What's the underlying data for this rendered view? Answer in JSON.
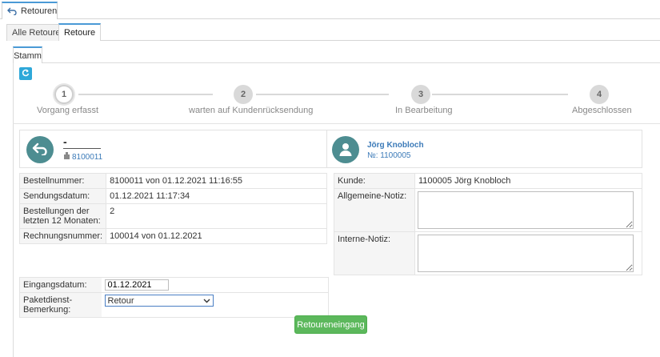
{
  "window_tab": {
    "label": "Retouren",
    "icon": "return-arrow-icon"
  },
  "tabs": [
    {
      "label": "Alle Retouren"
    },
    {
      "label": "Retoure"
    }
  ],
  "inner_tab": {
    "label": "Stamm"
  },
  "wizard": {
    "steps": [
      {
        "number": "1",
        "label": "Vorgang erfasst"
      },
      {
        "number": "2",
        "label": "warten auf Kundenrücksendung"
      },
      {
        "number": "3",
        "label": "In Bearbeitung"
      },
      {
        "number": "4",
        "label": "Abgeschlossen"
      }
    ],
    "current_step": 1
  },
  "return_card": {
    "title": "-",
    "order_ref": "8100011",
    "icon": "return-arrow-icon"
  },
  "customer_card": {
    "name": "Jörg Knobloch",
    "number": "№: 1100005",
    "icon": "user-icon"
  },
  "order_info": [
    {
      "label": "Bestellnummer:",
      "value": "8100011 von 01.12.2021 11:16:55"
    },
    {
      "label": "Sendungsdatum:",
      "value": "01.12.2021 11:17:34"
    },
    {
      "label": "Bestellungen der letzten 12 Monaten:",
      "value": "2"
    },
    {
      "label": "Rechnungsnummer:",
      "value": "100014 von 01.12.2021"
    }
  ],
  "customer_info": {
    "kunde_label": "Kunde:",
    "kunde_value": "1100005 Jörg Knobloch",
    "allgemeine_notiz_label": "Allgemeine-Notiz:",
    "interne_notiz_label": "Interne-Notiz:"
  },
  "receipt_form": {
    "eingangsdatum_label": "Eingangsdatum:",
    "eingangsdatum_value": "01.12.2021",
    "paketdienst_label": "Paketdienst-Bemerkung:",
    "paketdienst_value": "Retour"
  },
  "submit_button": {
    "label": "Retoureneingang"
  },
  "colors": {
    "accent": "#4a9ad6",
    "avatar": "#4d8d91",
    "success": "#5cb85c",
    "refresh": "#2fa8d9"
  }
}
